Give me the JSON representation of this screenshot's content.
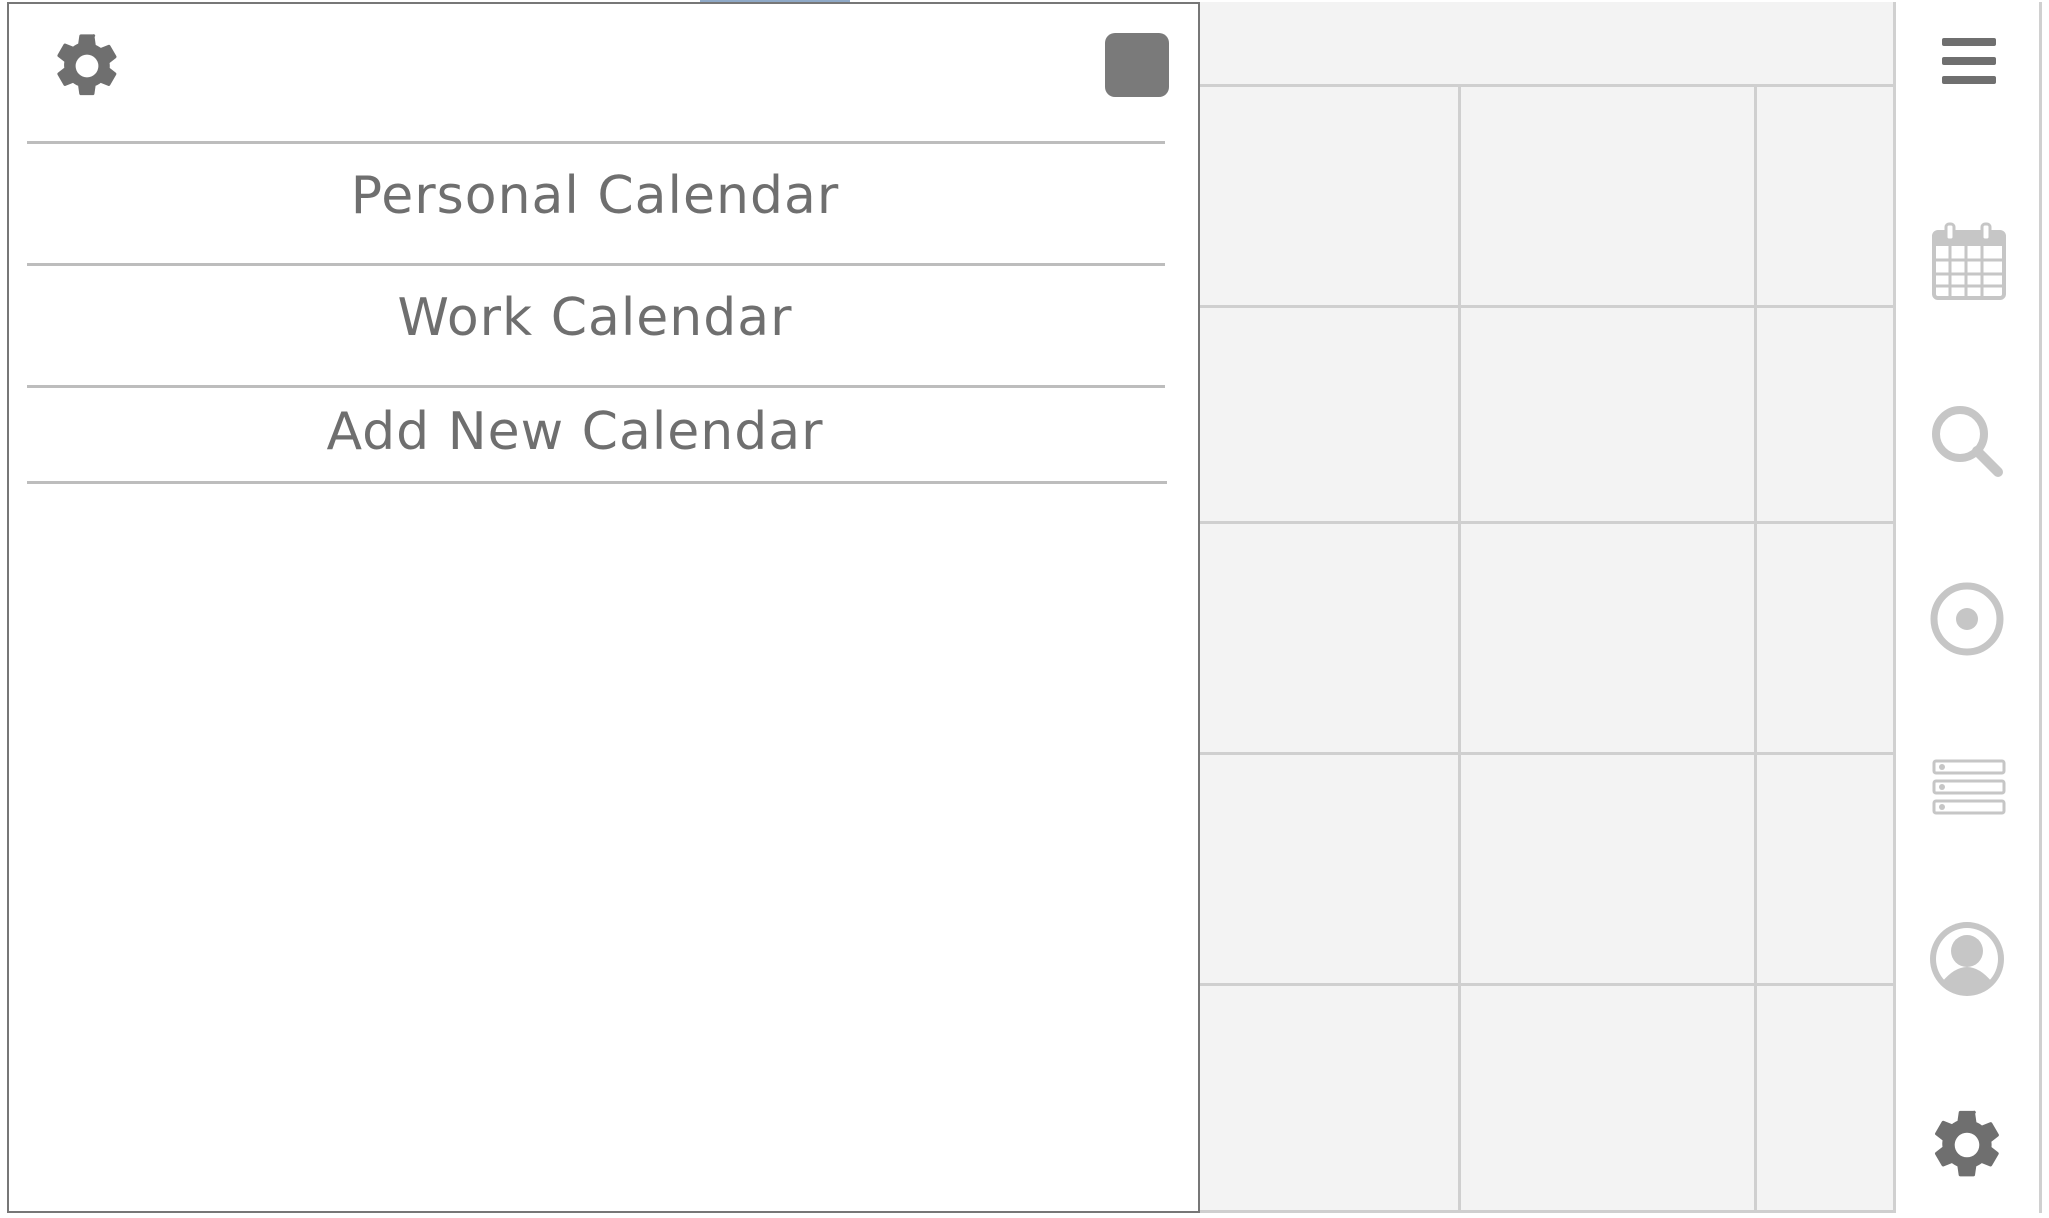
{
  "calendars": {
    "items": [
      {
        "label": "Personal Calendar"
      },
      {
        "label": "Work Calendar"
      },
      {
        "label": "Add New Calendar"
      }
    ]
  },
  "icons": {
    "drawer_settings": "gear-icon",
    "drawer_close": "close-square",
    "rail": [
      "menu-icon",
      "calendar-icon",
      "search-icon",
      "target-icon",
      "list-icon",
      "user-icon",
      "gear-icon"
    ]
  },
  "colors": {
    "text": "#6f6f6f",
    "icon_dark": "#7a7a7a",
    "icon_light": "#c6c6c6",
    "grid_bg": "#f3f3f3",
    "grid_line": "#cfcfcf"
  }
}
